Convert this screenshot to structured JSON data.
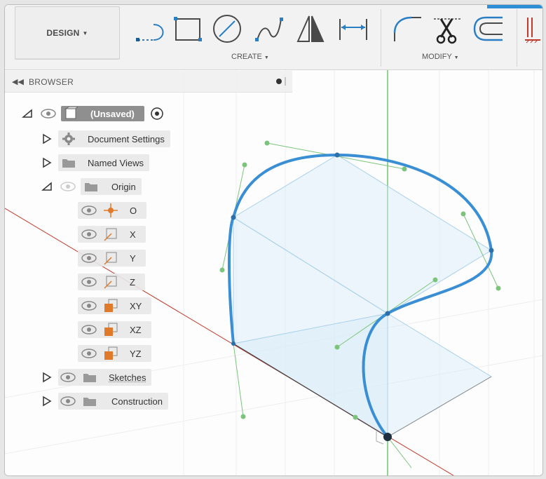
{
  "toolbar": {
    "workspace_label": "DESIGN",
    "create_label": "CREATE",
    "modify_label": "MODIFY",
    "create_icons": [
      "line-icon",
      "rectangle-icon",
      "circle-icon",
      "spline-icon",
      "mirror-icon",
      "dimension-icon"
    ],
    "modify_icons": [
      "fillet-icon",
      "trim-icon",
      "offset-icon",
      "constraint-icon"
    ],
    "accent_color": "#2f8fd6"
  },
  "browser": {
    "title": "BROWSER",
    "items": [
      {
        "label": "(Unsaved)",
        "icon": "component-icon"
      },
      {
        "label": "Document Settings",
        "icon": "gear-icon"
      },
      {
        "label": "Named Views",
        "icon": "folder-icon"
      },
      {
        "label": "Origin",
        "icon": "folder-icon"
      },
      {
        "label": "O",
        "icon": "origin-point-icon"
      },
      {
        "label": "X",
        "icon": "axis-icon"
      },
      {
        "label": "Y",
        "icon": "axis-icon"
      },
      {
        "label": "Z",
        "icon": "axis-icon"
      },
      {
        "label": "XY",
        "icon": "plane-icon"
      },
      {
        "label": "XZ",
        "icon": "plane-icon"
      },
      {
        "label": "YZ",
        "icon": "plane-icon"
      },
      {
        "label": "Sketches",
        "icon": "folder-icon"
      },
      {
        "label": "Construction",
        "icon": "folder-icon"
      }
    ]
  },
  "canvas": {
    "spline_color": "#3a8fd4",
    "plane_color": "#a9d0ea",
    "y_axis_color": "#4cb84c",
    "x_axis_color": "#c0392b"
  }
}
